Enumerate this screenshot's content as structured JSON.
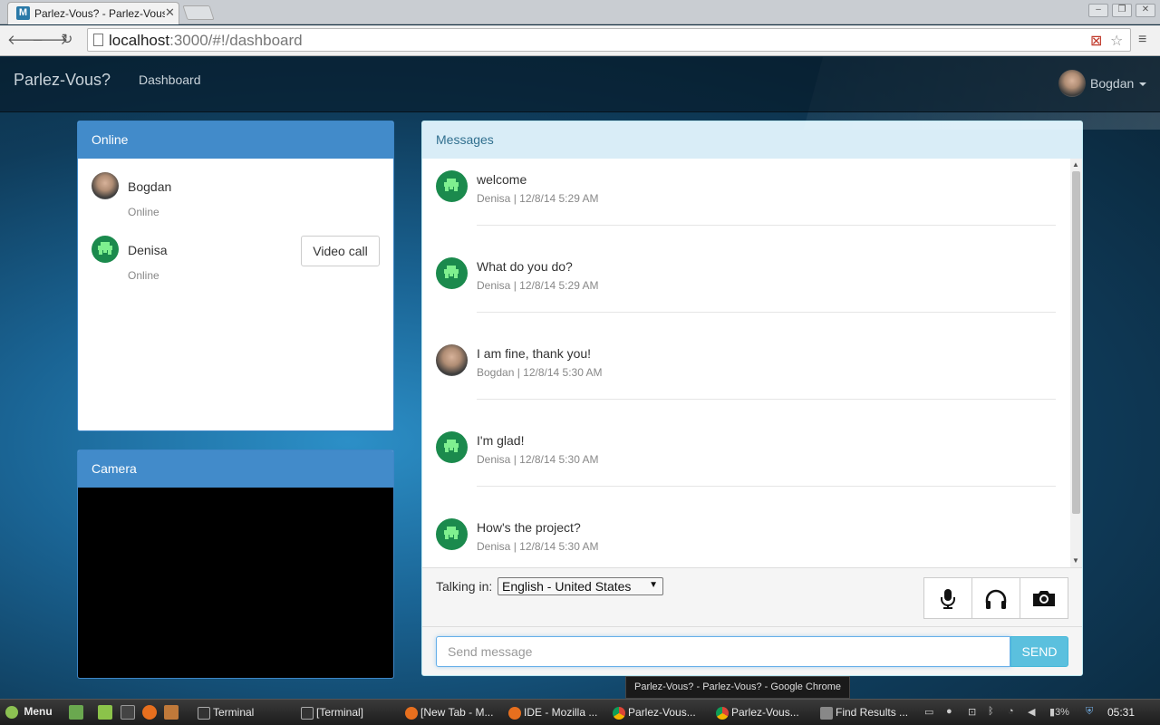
{
  "browser": {
    "tab_title": "Parlez-Vous? - Parlez-Vous?",
    "tab_favicon": "M",
    "url_host": "localhost",
    "url_rest": ":3000/#!/dashboard"
  },
  "navbar": {
    "brand": "Parlez-Vous?",
    "link_dashboard": "Dashboard",
    "user_name": "Bogdan"
  },
  "online": {
    "title": "Online",
    "users": [
      {
        "name": "Bogdan",
        "status": "Online"
      },
      {
        "name": "Denisa",
        "status": "Online",
        "action": "Video call"
      }
    ]
  },
  "camera": {
    "title": "Camera"
  },
  "messages": {
    "title": "Messages",
    "items": [
      {
        "text": "welcome",
        "meta": "Denisa | 12/8/14 5:29 AM",
        "avatar": "invader-avatar"
      },
      {
        "text": "What do you do?",
        "meta": "Denisa | 12/8/14 5:29 AM",
        "avatar": "invader-avatar"
      },
      {
        "text": "I am fine, thank you!",
        "meta": "Bogdan | 12/8/14 5:30 AM",
        "avatar": "photo-avatar"
      },
      {
        "text": "I'm glad!",
        "meta": "Denisa | 12/8/14 5:30 AM",
        "avatar": "invader-avatar"
      },
      {
        "text": "How's the project?",
        "meta": "Denisa | 12/8/14 5:30 AM",
        "avatar": "invader-avatar"
      }
    ],
    "talking_label": "Talking in:",
    "language": "English - United States",
    "send_placeholder": "Send message",
    "send_label": "SEND"
  },
  "tooltip": "Parlez-Vous? - Parlez-Vous? - Google Chrome",
  "taskbar": {
    "menu": "Menu",
    "windows": [
      "Terminal",
      "[Terminal]",
      "[New Tab - M...",
      "IDE - Mozilla ...",
      "Parlez-Vous...",
      "Parlez-Vous...",
      "Find Results ..."
    ],
    "battery": "3%",
    "clock": "05:31"
  },
  "colors": {
    "primary": "#428bca",
    "info": "#5bc0de",
    "invader_bg": "#1b8a4d",
    "invader_fg": "#7ff08f"
  }
}
